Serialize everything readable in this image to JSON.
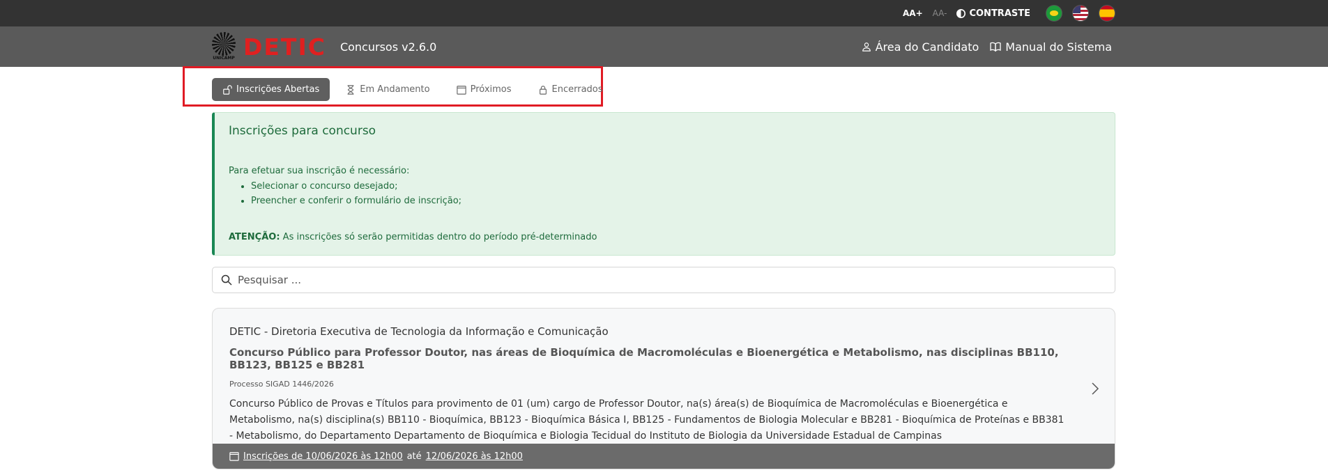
{
  "topbar": {
    "font_increase": "AA+",
    "font_decrease": "AA-",
    "contrast": "CONTRASTE"
  },
  "header": {
    "logo_text": "DETIC",
    "unicamp": "UNICAMP",
    "version": "Concursos v2.6.0",
    "candidate_area": "Área do Candidato",
    "manual": "Manual do Sistema"
  },
  "tabs": [
    {
      "label": "Inscrições Abertas",
      "icon": "unlock-icon",
      "active": true
    },
    {
      "label": "Em Andamento",
      "icon": "hourglass-icon",
      "active": false
    },
    {
      "label": "Próximos",
      "icon": "calendar-icon",
      "active": false
    },
    {
      "label": "Encerrados",
      "icon": "lock-icon",
      "active": false
    }
  ],
  "alert": {
    "title": "Inscrições para concurso",
    "intro": "Para efetuar sua inscrição é necessário:",
    "steps": [
      "Selecionar o concurso desejado;",
      "Preencher e conferir o formulário de inscrição;"
    ],
    "warning_label": "ATENÇÃO:",
    "warning_text": "As inscrições só serão permitidas dentro do período pré-determinado"
  },
  "search": {
    "placeholder": "Pesquisar ..."
  },
  "card": {
    "org": "DETIC - Diretoria Executiva de Tecnologia da Informação e Comunicação",
    "title": "Concurso Público para Professor Doutor, nas áreas de Bioquímica de Macromoléculas e Bioenergética e Metabolismo, nas disciplinas BB110, BB123, BB125 e BB281",
    "process": "Processo SIGAD 1446/2026",
    "description": "Concurso Público de Provas e Títulos para provimento de 01 (um) cargo de Professor Doutor, na(s) área(s) de Bioquímica de Macromoléculas e Bioenergética e Metabolismo, na(s) disciplina(s) BB110 - Bioquímica, BB123 - Bioquímica Básica I, BB125 - Fundamentos de Biologia Molecular e BB281 - Bioquímica de Proteínas e BB381 - Metabolismo, do Departamento Departamento de Bioquímica e Biologia Tecidual do Instituto de Biologia da Universidade Estadual de Campinas",
    "period_from": "Inscrições de 10/06/2026 às 12h00",
    "period_sep": "até",
    "period_to": "12/06/2026 às 12h00"
  },
  "colors": {
    "topbar": "#333333",
    "header": "#5a5a5a",
    "brand_red": "#e02020",
    "alert_bg": "#e4f3e8",
    "alert_text": "#1e6b3c",
    "highlight_box": "#e01b24"
  }
}
